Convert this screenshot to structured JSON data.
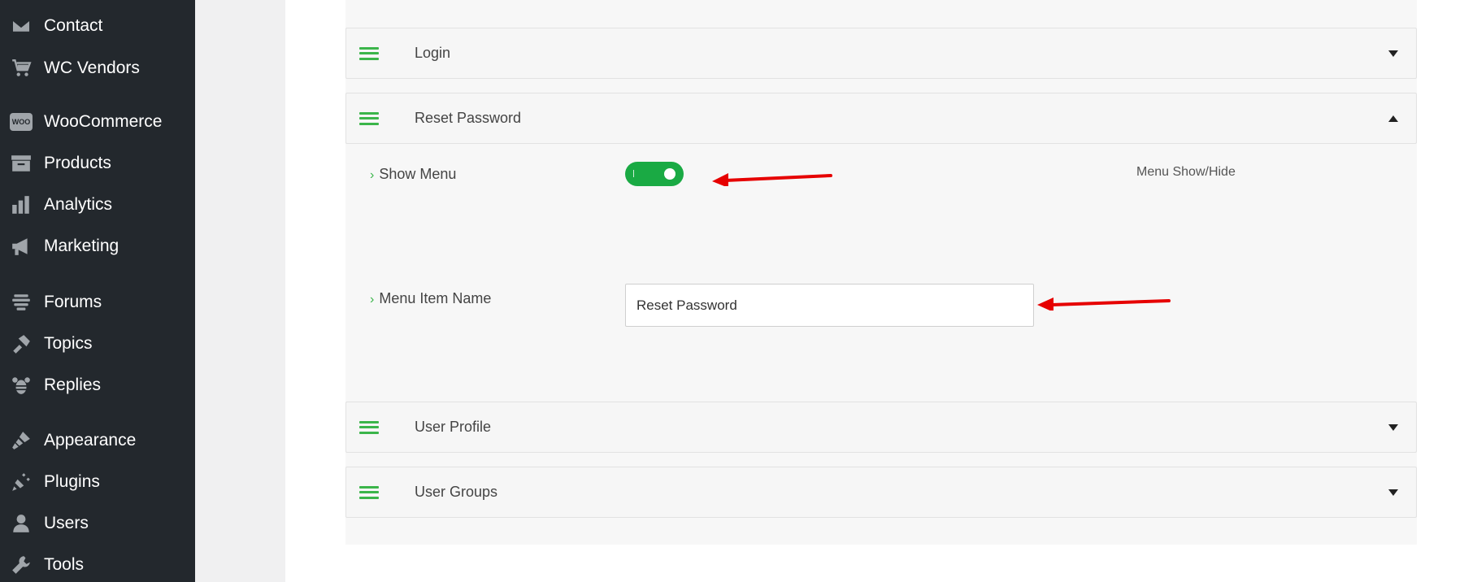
{
  "sidebar": {
    "items": [
      {
        "label": "Contact",
        "icon": "envelope-icon"
      },
      {
        "label": "WC Vendors",
        "icon": "cart-icon"
      },
      {
        "label": "WooCommerce",
        "icon": "woo-icon"
      },
      {
        "label": "Products",
        "icon": "archive-icon"
      },
      {
        "label": "Analytics",
        "icon": "bar-chart-icon"
      },
      {
        "label": "Marketing",
        "icon": "megaphone-icon"
      },
      {
        "label": "Forums",
        "icon": "forums-icon"
      },
      {
        "label": "Topics",
        "icon": "topics-icon"
      },
      {
        "label": "Replies",
        "icon": "replies-icon"
      },
      {
        "label": "Appearance",
        "icon": "paintbrush-icon"
      },
      {
        "label": "Plugins",
        "icon": "plug-icon"
      },
      {
        "label": "Users",
        "icon": "user-icon"
      },
      {
        "label": "Tools",
        "icon": "wrench-icon"
      }
    ],
    "woo_badge": "WOO"
  },
  "accordion": {
    "login": {
      "title": "Login"
    },
    "reset_password": {
      "title": "Reset Password"
    },
    "user_profile": {
      "title": "User Profile"
    },
    "user_groups": {
      "title": "User Groups"
    }
  },
  "reset_password_panel": {
    "show_menu_label": "Show Menu",
    "show_menu_enabled": true,
    "show_menu_help": "Menu Show/Hide",
    "menu_item_name_label": "Menu Item Name",
    "menu_item_name_value": "Reset Password"
  },
  "colors": {
    "sidebar_bg": "#23282d",
    "accent_green": "#1aaa44",
    "annotation_red": "#e60000"
  }
}
